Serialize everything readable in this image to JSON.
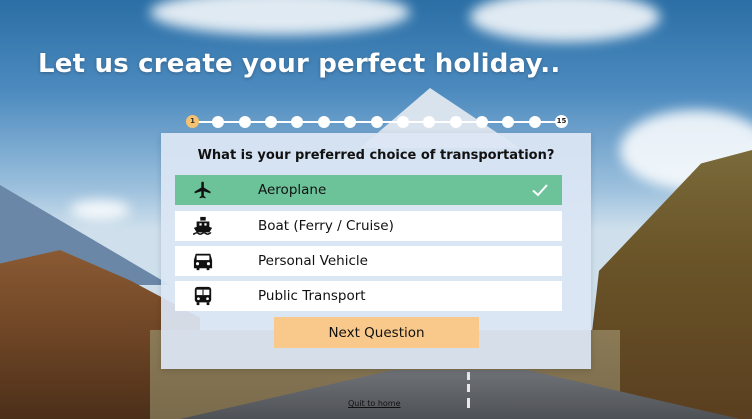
{
  "header": {
    "title": "Let us create your perfect holiday.."
  },
  "progress": {
    "current": "1",
    "total": "15",
    "current_step": 1,
    "total_steps": 15
  },
  "question": {
    "text": "What is your preferred choice of transportation?",
    "options": [
      {
        "label": "Aeroplane",
        "icon": "airplane-icon",
        "selected": true
      },
      {
        "label": "Boat (Ferry / Cruise)",
        "icon": "ship-icon",
        "selected": false
      },
      {
        "label": "Personal Vehicle",
        "icon": "car-icon",
        "selected": false
      },
      {
        "label": "Public Transport",
        "icon": "bus-icon",
        "selected": false
      }
    ]
  },
  "actions": {
    "next_label": "Next Question",
    "quit_label": "Quit to home"
  },
  "colors": {
    "selected": "#6cc39a",
    "button": "#f8c98a",
    "progress_current": "#f4c270",
    "card": "#dce6f4"
  }
}
